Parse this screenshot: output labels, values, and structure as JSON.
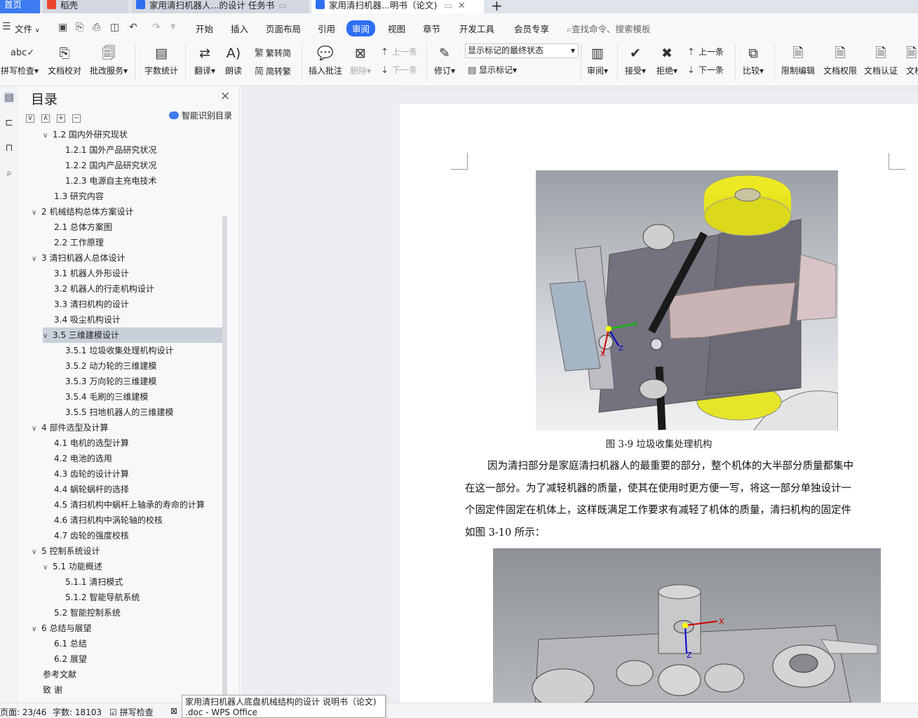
{
  "tabs": [
    {
      "label": "首页"
    },
    {
      "label": "稻壳"
    },
    {
      "label": "家用清扫机器人...的设计 任务书"
    },
    {
      "label": "家用清扫机器...明书（论文)"
    }
  ],
  "menu": {
    "file": "文件",
    "items": [
      "开始",
      "插入",
      "页面布局",
      "引用",
      "审阅",
      "视图",
      "章节",
      "开发工具",
      "会员专享"
    ],
    "search": "查找命令、搜索模板"
  },
  "ribbon": {
    "spellcheck": "拼写检查",
    "doc_proof": "文档校对",
    "batch_service": "批改服务",
    "word_count": "字数统计",
    "translate": "翻译",
    "read_aloud": "朗读",
    "to_traditional": "繁转简",
    "to_simplified": "简转繁",
    "insert_comment": "插入批注",
    "delete": "删除",
    "prev_comment": "上一条",
    "next_comment": "下一条",
    "track": "修订",
    "markup_select": "显示标记的最终状态",
    "show_markup": "显示标记",
    "review": "审阅",
    "accept": "接受",
    "reject": "拒绝",
    "prev_change": "上一条",
    "next_change": "下一条",
    "compare": "比较",
    "restrict": "限制编辑",
    "doc_rights": "文档权限",
    "doc_auth": "文档认证",
    "doc_more": "文档"
  },
  "nav": {
    "title": "目录",
    "smart": "智能识别目录",
    "items": [
      {
        "text": "1.2  国内外研究现状",
        "level": 1,
        "chev": "∨"
      },
      {
        "text": "1.2.1  国外产品研究状况",
        "level": 2,
        "chev": ""
      },
      {
        "text": "1.2.2  国内产品研究状况",
        "level": 2,
        "chev": ""
      },
      {
        "text": "1.2.3  电源自主充电技术",
        "level": 2,
        "chev": ""
      },
      {
        "text": "1.3  研究内容",
        "level": 1,
        "chev": ""
      },
      {
        "text": "2  机械结构总体方案设计",
        "level": 0,
        "chev": "∨"
      },
      {
        "text": "2.1  总体方案图",
        "level": 1,
        "chev": ""
      },
      {
        "text": "2.2  工作原理",
        "level": 1,
        "chev": ""
      },
      {
        "text": "3  清扫机器人总体设计",
        "level": 0,
        "chev": "∨"
      },
      {
        "text": "3.1  机器人外形设计",
        "level": 1,
        "chev": ""
      },
      {
        "text": "3.2  机器人的行走机构设计",
        "level": 1,
        "chev": ""
      },
      {
        "text": "3.3  清扫机构的设计",
        "level": 1,
        "chev": ""
      },
      {
        "text": "3.4  吸尘机构设计",
        "level": 1,
        "chev": ""
      },
      {
        "text": "3.5  三维建模设计",
        "level": 1,
        "chev": "∨",
        "selected": true
      },
      {
        "text": "3.5.1  垃圾收集处理机构设计",
        "level": 2,
        "chev": ""
      },
      {
        "text": "3.5.2  动力轮的三维建模",
        "level": 2,
        "chev": ""
      },
      {
        "text": "3.5.3  万向轮的三维建模",
        "level": 2,
        "chev": ""
      },
      {
        "text": "3.5.4  毛刷的三维建模",
        "level": 2,
        "chev": ""
      },
      {
        "text": "3.5.5  扫地机器人的三维建模",
        "level": 2,
        "chev": ""
      },
      {
        "text": "4  部件选型及计算",
        "level": 0,
        "chev": "∨"
      },
      {
        "text": "4.1  电机的选型计算",
        "level": 1,
        "chev": ""
      },
      {
        "text": "4.2  电池的选用",
        "level": 1,
        "chev": ""
      },
      {
        "text": "4.3  齿轮的设计计算",
        "level": 1,
        "chev": ""
      },
      {
        "text": "4.4  蜗轮蜗杆的选择",
        "level": 1,
        "chev": ""
      },
      {
        "text": "4.5  清扫机构中蜗杆上轴承的寿命的计算",
        "level": 1,
        "chev": ""
      },
      {
        "text": "4.6  清扫机构中涡轮轴的校核",
        "level": 1,
        "chev": ""
      },
      {
        "text": "4.7  齿轮的强度校核",
        "level": 1,
        "chev": ""
      },
      {
        "text": "5  控制系统设计",
        "level": 0,
        "chev": "∨"
      },
      {
        "text": "5.1  功能概述",
        "level": 1,
        "chev": "∨"
      },
      {
        "text": "5.1.1  清扫模式",
        "level": 2,
        "chev": ""
      },
      {
        "text": "5.1.2  智能导航系统",
        "level": 2,
        "chev": ""
      },
      {
        "text": "5.2  智能控制系统",
        "level": 1,
        "chev": ""
      },
      {
        "text": "6  总结与展望",
        "level": 0,
        "chev": "∨"
      },
      {
        "text": "6.1  总结",
        "level": 1,
        "chev": ""
      },
      {
        "text": "6.2  展望",
        "level": 1,
        "chev": ""
      },
      {
        "text": "参考文献",
        "level": 0,
        "chev": ""
      },
      {
        "text": "致    谢",
        "level": 0,
        "chev": ""
      }
    ]
  },
  "doc": {
    "caption": "图 3-9  垃圾收集处理机构",
    "lines": [
      "因为清扫部分是家庭清扫机器人的最重要的部分，整个机体的大半部分质量都集中",
      "在这一部分。为了减轻机器的质量，使其在使用时更方便一写，将这一部分单独设计一",
      "个固定件固定在机体上，这样既满足工作要求有减轻了机体的质量，清扫机构的固定件",
      "如图 3-10 所示："
    ]
  },
  "status": {
    "page": "页面: 23/46",
    "words": "字数: 18103",
    "spell": "拼写检查"
  },
  "tooltip": {
    "line1": "家用清扫机器人底盘机械结构的设计 说明书（论文)",
    "line2": ".doc - WPS Office"
  }
}
